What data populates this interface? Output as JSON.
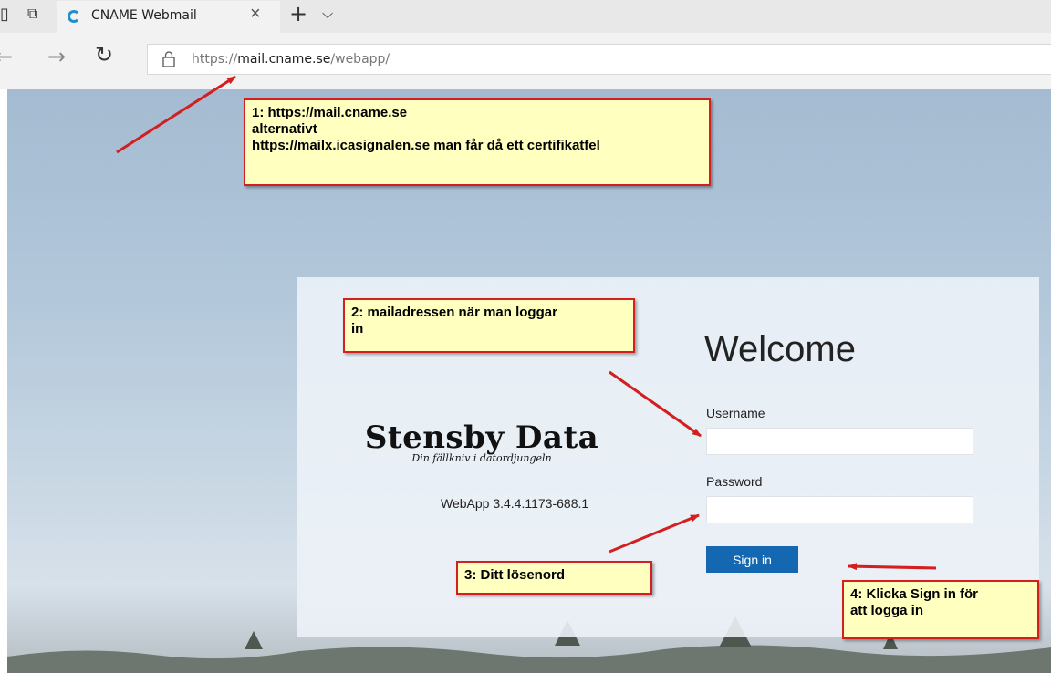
{
  "browser": {
    "tab": {
      "title": "CNAME Webmail",
      "close_icon": "×"
    },
    "new_tab_icon": "+",
    "tab_menu_icon": "⌵",
    "url": {
      "scheme": "https://",
      "host": "mail.cname.se",
      "path": "/webapp/"
    }
  },
  "login": {
    "logo": {
      "title": "Stensby Data",
      "subtitle": "Din fällkniv i datordjungeln"
    },
    "version": "WebApp 3.4.4.1173-688.1",
    "welcome": "Welcome",
    "username_label": "Username",
    "username_value": "",
    "password_label": "Password",
    "password_value": "",
    "sign_in_label": "Sign in",
    "button_color": "#1468b1"
  },
  "annotations": [
    {
      "text": "1: https://mail.cname.se\nalternativt\nhttps://mailx.icasignalen.se man får då ett certifikatfel"
    },
    {
      "text": "2: mailadressen när man loggar\nin"
    },
    {
      "text": "3: Ditt lösenord"
    },
    {
      "text": "4: Klicka Sign in för\natt logga in"
    }
  ],
  "annotation_colors": {
    "fill": "#ffffc0",
    "border": "#d21f1f",
    "arrow": "#d21f1f"
  }
}
